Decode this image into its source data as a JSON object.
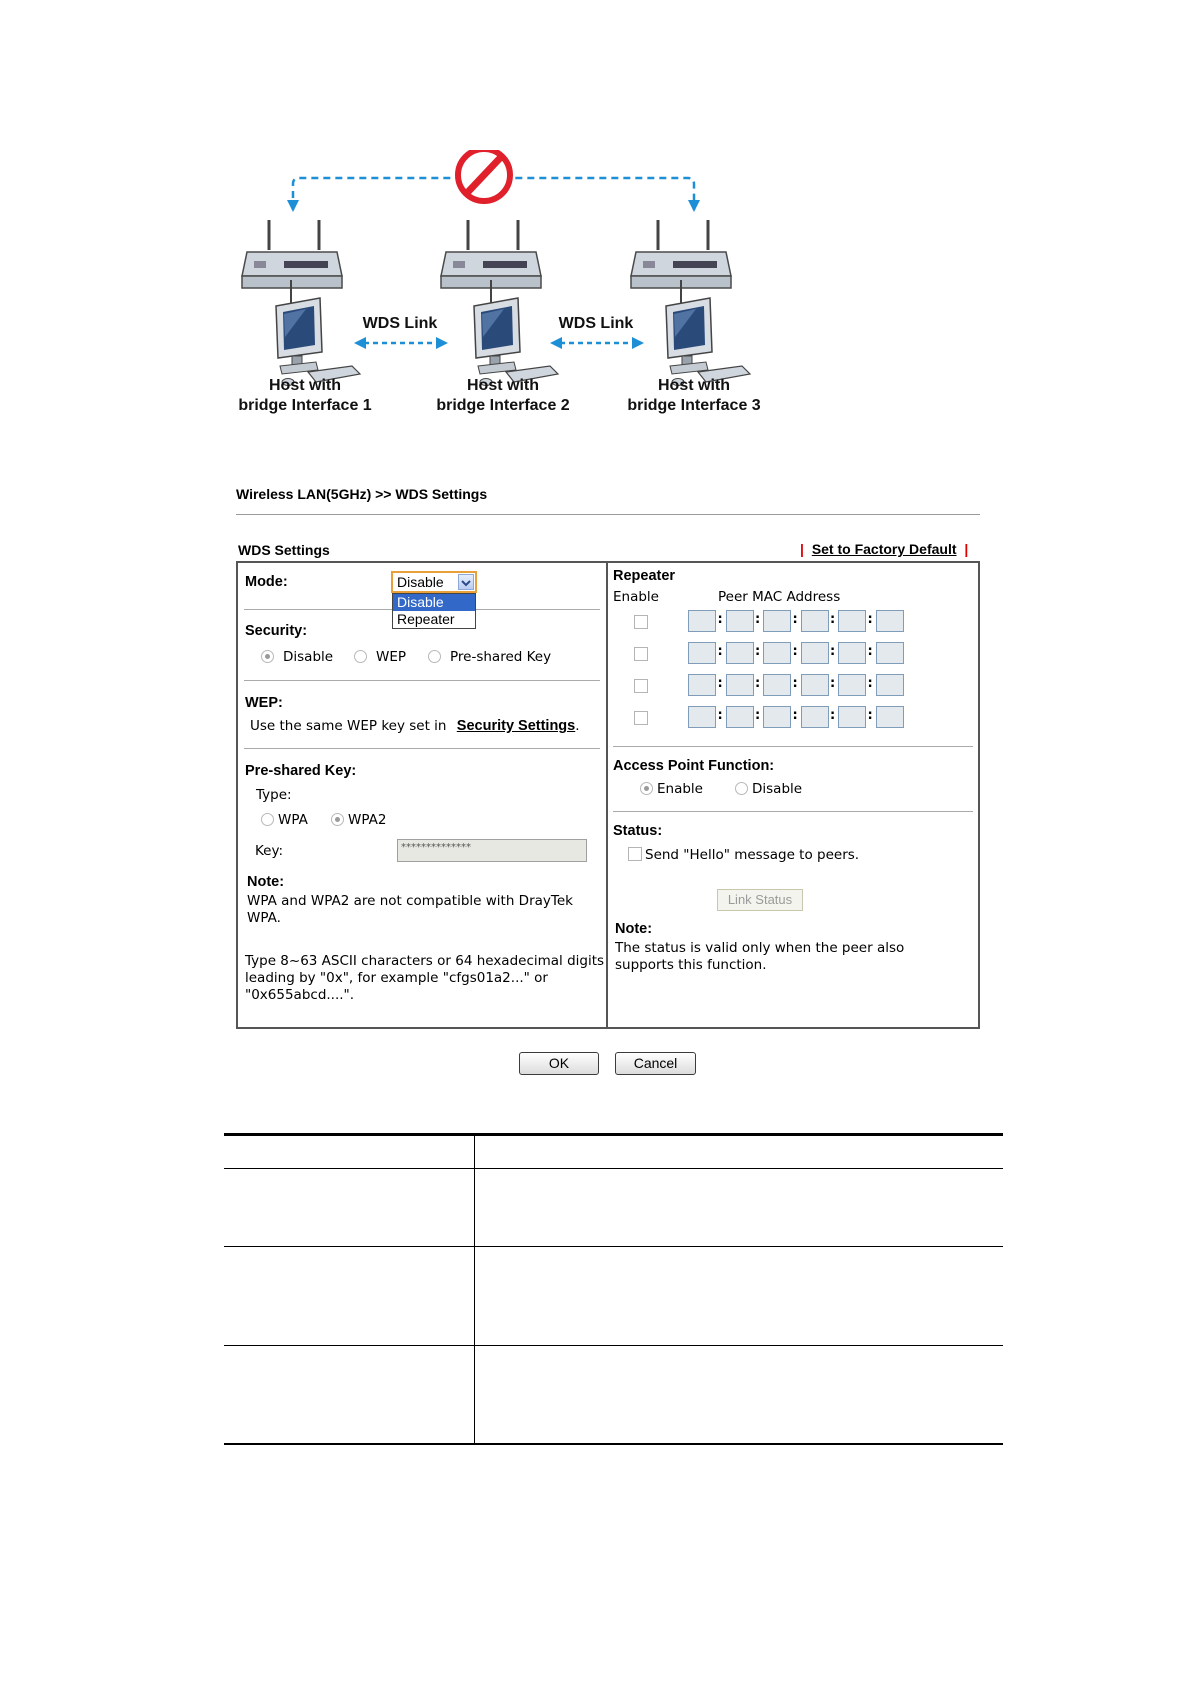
{
  "diagram": {
    "link_label_left": "WDS Link",
    "link_label_right": "WDS Link",
    "hosts": [
      {
        "line1": "Host with",
        "line2": "bridge Interface 1"
      },
      {
        "line1": "Host with",
        "line2": "bridge Interface 2"
      },
      {
        "line1": "Host with",
        "line2": "bridge Interface 3"
      }
    ],
    "colors": {
      "link": "#1c8fd6",
      "prohibited": "#e0202a"
    }
  },
  "page": {
    "breadcrumb": "Wireless LAN(5GHz) >> WDS Settings",
    "section_title": "WDS Settings",
    "factory_default_link": "Set to Factory Default"
  },
  "left": {
    "mode_label": "Mode:",
    "mode_value": "Disable",
    "mode_options": [
      "Disable",
      "Repeater"
    ],
    "security_label": "Security:",
    "security_options": [
      "Disable",
      "WEP",
      "Pre-shared Key"
    ],
    "security_selected": "Disable",
    "wep_label": "WEP:",
    "wep_text": "Use the same WEP key set in",
    "wep_link": "Security Settings",
    "wep_period": ".",
    "psk_label": "Pre-shared Key:",
    "type_label": "Type:",
    "type_options": [
      "WPA",
      "WPA2"
    ],
    "type_selected": "WPA2",
    "key_label": "Key:",
    "key_value": "**************",
    "note_label": "Note:",
    "note_text1": "WPA and WPA2 are not compatible with DrayTek WPA.",
    "note_text2": "Type 8~63 ASCII characters or 64 hexadecimal digits leading by \"0x\", for example \"cfgs01a2...\" or \"0x655abcd....\"."
  },
  "right": {
    "repeater_label": "Repeater",
    "enable_col": "Enable",
    "mac_col": "Peer MAC Address",
    "mac_rows": 4,
    "apf_label": "Access Point Function:",
    "apf_options": [
      "Enable",
      "Disable"
    ],
    "apf_selected": "Enable",
    "status_label": "Status:",
    "status_check_text": "Send \"Hello\" message to peers.",
    "link_status_button": "Link Status",
    "note_label": "Note:",
    "note_text": "The status is valid only when the peer also supports this function."
  },
  "buttons": {
    "ok": "OK",
    "cancel": "Cancel"
  }
}
